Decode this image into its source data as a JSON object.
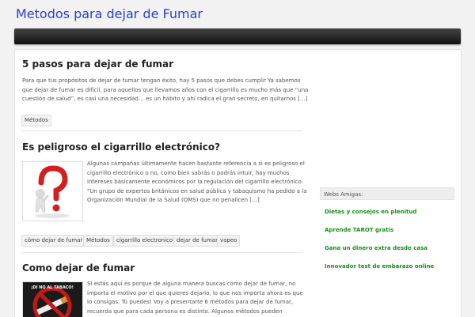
{
  "site": {
    "title": "Metodos para dejar de Fumar"
  },
  "posts": [
    {
      "title": "5 pasos para dejar de fumar",
      "lines": [
        "Para que tus propósitos de dejar de fumar tengan éxito, hay 5 pasos que debes cumplir Ya sabemos",
        "que dejar de fumar es difícil, para aquellos que llevamos años con el cigarrillo es mucho más que “una",
        "cuestión de salud”, es casi una necesidad… es un hábito y ahí radica el gran secreto, en quitarnos […]"
      ],
      "tags": [
        "Métodos"
      ]
    },
    {
      "title": "Es peligroso el cigarrillo electrónico?",
      "lines": [
        "Algunas campañas últimamente hacen bastante referencia a si es peligroso el",
        "cigarrillo electrónico o no, como bien sabrás o podrás intuir, hay muchos",
        "intereses básicamente económicos por la regulación del cigarrillo electrónico.",
        "\"Un grupo de expertos británicos en salud pública y tabaquismo ha pedido a la",
        "Organización Mundial de la Salud (OMS) que no penalicen […]"
      ],
      "tags": [
        "cómo dejar de fumar",
        "Métodos",
        "cigarrillo electronico",
        "dejar de fumar",
        "vapeo"
      ]
    },
    {
      "title": "Como dejar de fumar",
      "lines": [
        "Si estás aquí es porque de alguna manera buscas como dejar de fumar, no",
        "importa el motivo por el que quieres dejarlo, lo que nos importa ahora es que",
        "lo consigas. Tú puedes! Voy a presentarte 6 métodos para dejar de fumar,",
        "recuerda que para cada persona es distinto. Algunos métodos pueden"
      ],
      "thumb_text": "¡DI NO AL TABACO!"
    }
  ],
  "sidebar": {
    "widget_title": "Webs Amigas:",
    "links": [
      "Dietas y consejos en plenitud",
      "Aprende TAROT gratis",
      "Gana un dinero extra desde casa",
      "Innovador test de embarazo online"
    ]
  },
  "colors": {
    "title_blue": "#2f3fc5",
    "link_green": "#169016",
    "navbar": "#1b1b1b"
  }
}
